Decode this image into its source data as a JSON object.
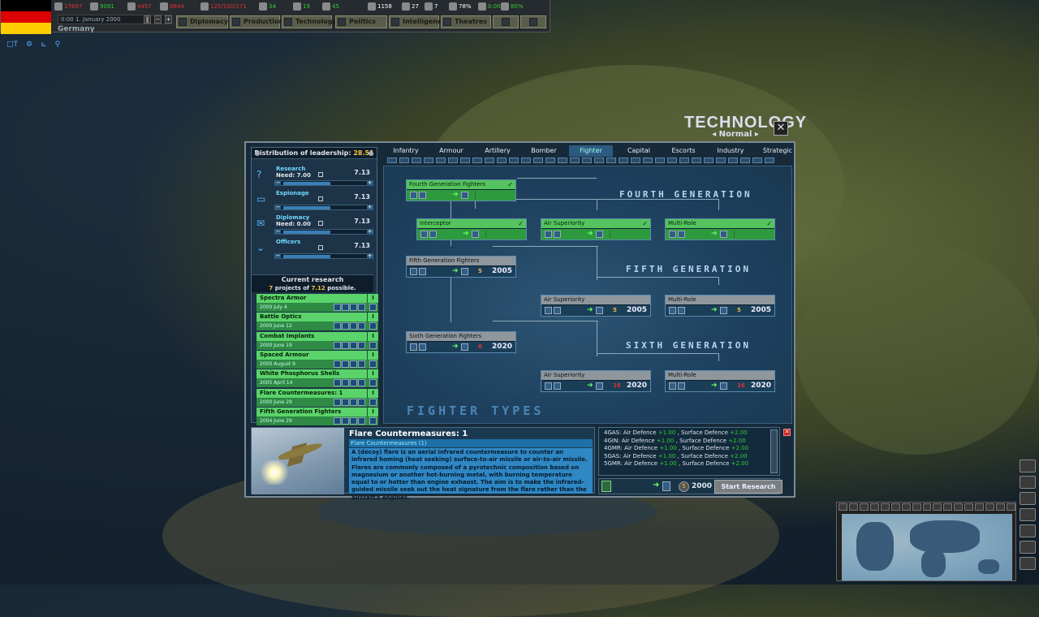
{
  "topbar": {
    "resources": [
      {
        "icon": "energy-icon",
        "value": "17697",
        "color": "#d33"
      },
      {
        "icon": "metal-icon",
        "value": "9091",
        "color": "#3c3"
      },
      {
        "icon": "rare-materials-icon",
        "value": "4457",
        "color": "#d33"
      },
      {
        "icon": "oil-icon",
        "value": "8844",
        "color": "#d33"
      },
      {
        "icon": "supplies-icon",
        "value": "125/100/171",
        "color": "#d33"
      },
      {
        "icon": "fuel-icon",
        "value": "34",
        "color": "#3c3"
      },
      {
        "icon": "money-icon",
        "value": "19",
        "color": "#3c3"
      },
      {
        "icon": "manpower-icon",
        "value": "45",
        "color": "#3c3"
      },
      {
        "icon": "leadership-icon",
        "value": "1158",
        "color": "#fff"
      },
      {
        "icon": "diplomats-icon",
        "value": "27",
        "color": "#fff"
      },
      {
        "icon": "spies-icon",
        "value": "7",
        "color": "#fff"
      },
      {
        "icon": "national-unity-icon",
        "value": "78%",
        "color": "#fff"
      },
      {
        "icon": "dissent-icon",
        "value": "0.00",
        "color": "#3c3"
      },
      {
        "icon": "threat-icon",
        "value": "80%",
        "color": "#3c3"
      }
    ],
    "date": "0:00 1. January 2000",
    "country": "Germany",
    "nav": [
      "Diplomacy",
      "Production",
      "Technology",
      "Politics",
      "Intelligence",
      "Theatres"
    ]
  },
  "technology": {
    "title": "TECHNOLOGY",
    "mode": "Normal",
    "leadership": {
      "heading": "Distribution of leadership:",
      "total": "28.51",
      "rows": [
        {
          "name": "Research",
          "need": "Need: 7.00",
          "value": "7.13",
          "icon": "flask-icon"
        },
        {
          "name": "Espionage",
          "need": "",
          "value": "7.13",
          "icon": "spy-icon"
        },
        {
          "name": "Diplomacy",
          "need": "Need: 0.00",
          "value": "7.13",
          "icon": "envelope-icon"
        },
        {
          "name": "Officers",
          "need": "",
          "value": "7.13",
          "icon": "chevron-icon"
        }
      ]
    },
    "current": {
      "heading": "Current research",
      "count": "7",
      "mid": "projects of",
      "possible": "7.12",
      "tail": "possible.",
      "items": [
        {
          "name": "Spectra Armor",
          "date": "2000 July 4"
        },
        {
          "name": "Battle Optics",
          "date": "2000 June 12"
        },
        {
          "name": "Combat Implants",
          "date": "2000 June 19"
        },
        {
          "name": "Spaced Armour",
          "date": "2000 August 9"
        },
        {
          "name": "White Phosphorus Shells",
          "date": "2005 April 14"
        },
        {
          "name": "Flare Countermeasures: 1",
          "date": "2000 June 29"
        },
        {
          "name": "Fifth Generation Fighters",
          "date": "2004 June 29"
        }
      ]
    },
    "tabs": [
      "Infantry",
      "Armour",
      "Artillery",
      "Bomber",
      "Fighter",
      "Capital",
      "Escorts",
      "Industry",
      "Strategic"
    ],
    "selected_tab": "Fighter",
    "tree": {
      "gen4": "FOURTH GENERATION",
      "gen5": "FIFTH GENERATION",
      "gen6": "SIXTH GENERATION",
      "footer": "FIGHTER TYPES",
      "nodes": {
        "fourth": {
          "name": "Fourth Generation Fighters"
        },
        "interceptor": {
          "name": "Interceptor"
        },
        "air4": {
          "name": "Air Superiority"
        },
        "multi4": {
          "name": "Multi-Role"
        },
        "fifth": {
          "name": "Fifth Generation Fighters",
          "cost": "5",
          "year": "2005"
        },
        "air5": {
          "name": "Air Superiority",
          "cost": "5",
          "year": "2005"
        },
        "multi5": {
          "name": "Multi-Role",
          "cost": "5",
          "year": "2005"
        },
        "sixth": {
          "name": "Sixth Generation Fighters",
          "cost": "6",
          "year": "2020"
        },
        "air6": {
          "name": "Air Superiority",
          "cost": "16",
          "year": "2020"
        },
        "multi6": {
          "name": "Multi-Role",
          "cost": "16",
          "year": "2020"
        }
      }
    },
    "detail": {
      "title": "Flare Countermeasures: 1",
      "subtitle": "Flare Countermeasures (1)",
      "text": "A (decoy) flare is an aerial infrared countermeasure to counter an infrared homing (heat seeking) surface-to-air missile or air-to-air missile. Flares are commonly composed of a pyrotechnic composition based on magnesium or another hot-burning metal, with burning temperature equal to or hotter than engine exhaust. The aim is to make the infrared-guided missile seek out the heat signature from the flare rather than the aircraft's engines."
    },
    "effects": [
      {
        "unit": "4GAS:",
        "a": "Air Defence",
        "av": "+1.00",
        "b": "Surface Defence",
        "bv": "+2.00"
      },
      {
        "unit": "4GIN:",
        "a": "Air Defence",
        "av": "+1.00",
        "b": "Surface Defence",
        "bv": "+2.00"
      },
      {
        "unit": "4GMR:",
        "a": "Air Defence",
        "av": "+1.00",
        "b": "Surface Defence",
        "bv": "+2.00"
      },
      {
        "unit": "5GAS:",
        "a": "Air Defence",
        "av": "+1.00",
        "b": "Surface Defence",
        "bv": "+2.00"
      },
      {
        "unit": "5GMR:",
        "a": "Air Defence",
        "av": "+1.00",
        "b": "Surface Defence",
        "bv": "+2.00"
      }
    ],
    "action": {
      "cost": "5",
      "year": "2000",
      "start_label": "Start Research"
    }
  }
}
